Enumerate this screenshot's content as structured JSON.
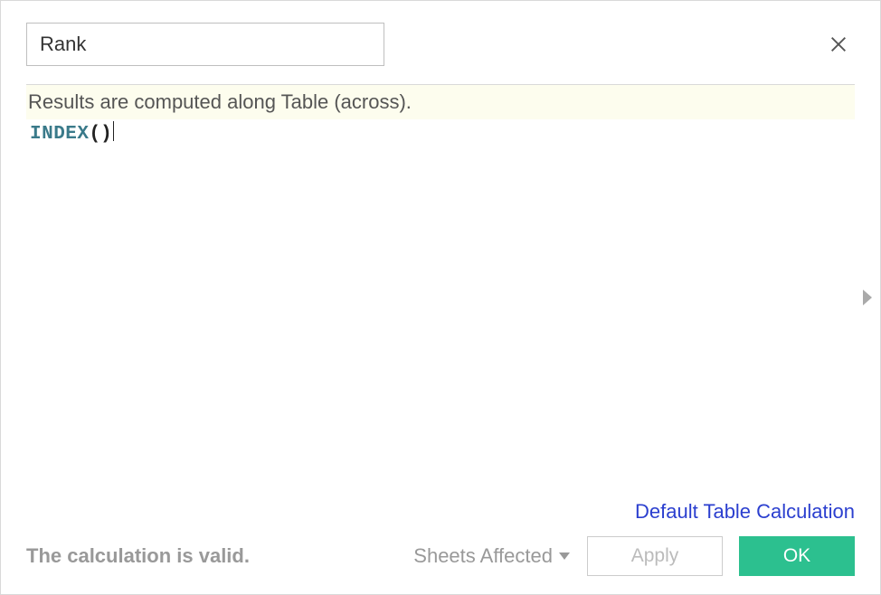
{
  "header": {
    "name_value": "Rank"
  },
  "editor": {
    "hint": "Results are computed along Table (across).",
    "formula_function": "INDEX",
    "formula_parens": "()"
  },
  "footer": {
    "table_calc_link": "Default Table Calculation",
    "status": "The calculation is valid.",
    "sheets_affected_label": "Sheets Affected",
    "apply_label": "Apply",
    "ok_label": "OK"
  }
}
